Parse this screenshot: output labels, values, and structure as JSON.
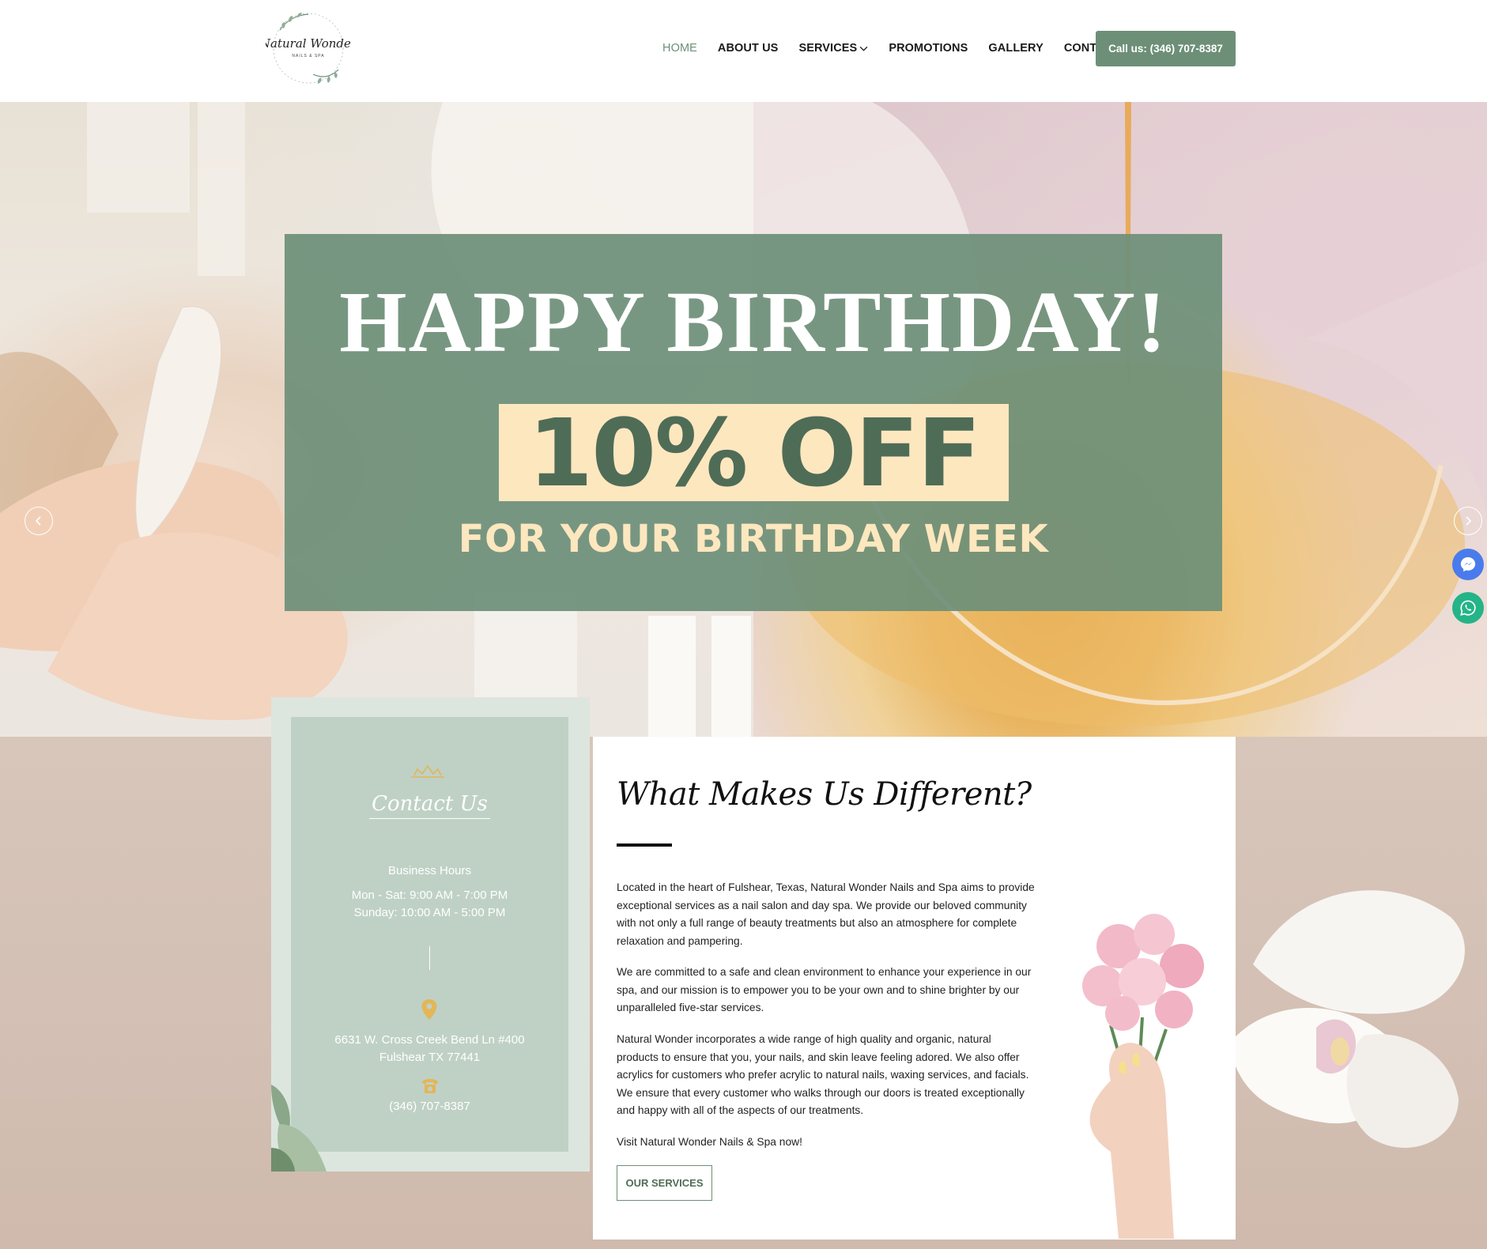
{
  "header": {
    "logo": {
      "name": "Natural Wonder",
      "tagline": "NAILS & SPA"
    },
    "nav": [
      {
        "label": "HOME",
        "active": true
      },
      {
        "label": "ABOUT US",
        "active": false
      },
      {
        "label": "SERVICES",
        "active": false,
        "dropdown": true
      },
      {
        "label": "PROMOTIONS",
        "active": false
      },
      {
        "label": "GALLERY",
        "active": false
      },
      {
        "label": "CONTACT",
        "active": false
      }
    ],
    "call_button": "Call us: (346) 707-8387"
  },
  "hero": {
    "promo_title": "HAPPY BIRTHDAY!",
    "promo_discount": "10% OFF",
    "promo_subtitle": "FOR YOUR BIRTHDAY WEEK",
    "prev_icon": "chevron-left-icon",
    "next_icon": "chevron-right-icon"
  },
  "contact": {
    "title": "Contact Us",
    "hours_title": "Business Hours",
    "hours": [
      "Mon - Sat: 9:00 AM - 7:00 PM",
      "Sunday: 10:00 AM - 5:00 PM"
    ],
    "address": [
      "6631 W. Cross Creek Bend Ln #400",
      "Fulshear TX 77441"
    ],
    "phone": "(346) 707-8387"
  },
  "about": {
    "title": "What Makes Us Different?",
    "paragraphs": [
      "Located in the heart of Fulshear, Texas, Natural Wonder Nails and Spa aims to provide exceptional services as a nail salon and day spa. We provide our beloved community with not only a full range of beauty treatments but also an atmosphere for complete relaxation and pampering.",
      "We are committed to a safe and clean environment to enhance your experience in our spa, and our mission is to empower you to be your own and to shine brighter by our unparalleled five-star services.",
      "Natural Wonder incorporates a wide range of high quality and organic, natural products to ensure that you, your nails, and skin leave feeling adored. We also offer acrylics for customers who prefer acrylic to natural nails, waxing services, and facials. We ensure that every customer who walks through our doors is treated exceptionally and happy with all of the aspects of our treatments.",
      "Visit Natural Wonder Nails & Spa now!"
    ],
    "button": "OUR SERVICES"
  },
  "floating": {
    "messenger_icon": "messenger-icon",
    "whatsapp_icon": "whatsapp-icon"
  },
  "colors": {
    "brand_green": "#6d8f78",
    "promo_cream": "#fde7bf",
    "contact_bg": "#bfd1c5"
  }
}
